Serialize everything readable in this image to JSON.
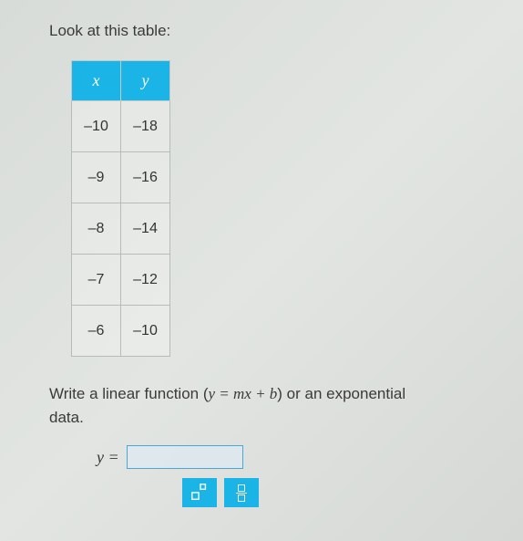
{
  "prompt_text": "Look at this table:",
  "table": {
    "headers": {
      "x": "x",
      "y": "y"
    },
    "rows": [
      {
        "x": "–10",
        "y": "–18"
      },
      {
        "x": "–9",
        "y": "–16"
      },
      {
        "x": "–8",
        "y": "–14"
      },
      {
        "x": "–7",
        "y": "–12"
      },
      {
        "x": "–6",
        "y": "–10"
      }
    ]
  },
  "instruction_pre": "Write a linear function (",
  "instruction_math": "y = mx + b",
  "instruction_post": ") or an exponential",
  "instruction_line2": "data.",
  "answer_label": "y =",
  "answer_value": "",
  "chart_data": {
    "type": "table",
    "columns": [
      "x",
      "y"
    ],
    "rows": [
      [
        -10,
        -18
      ],
      [
        -9,
        -16
      ],
      [
        -8,
        -14
      ],
      [
        -7,
        -12
      ],
      [
        -6,
        -10
      ]
    ]
  }
}
